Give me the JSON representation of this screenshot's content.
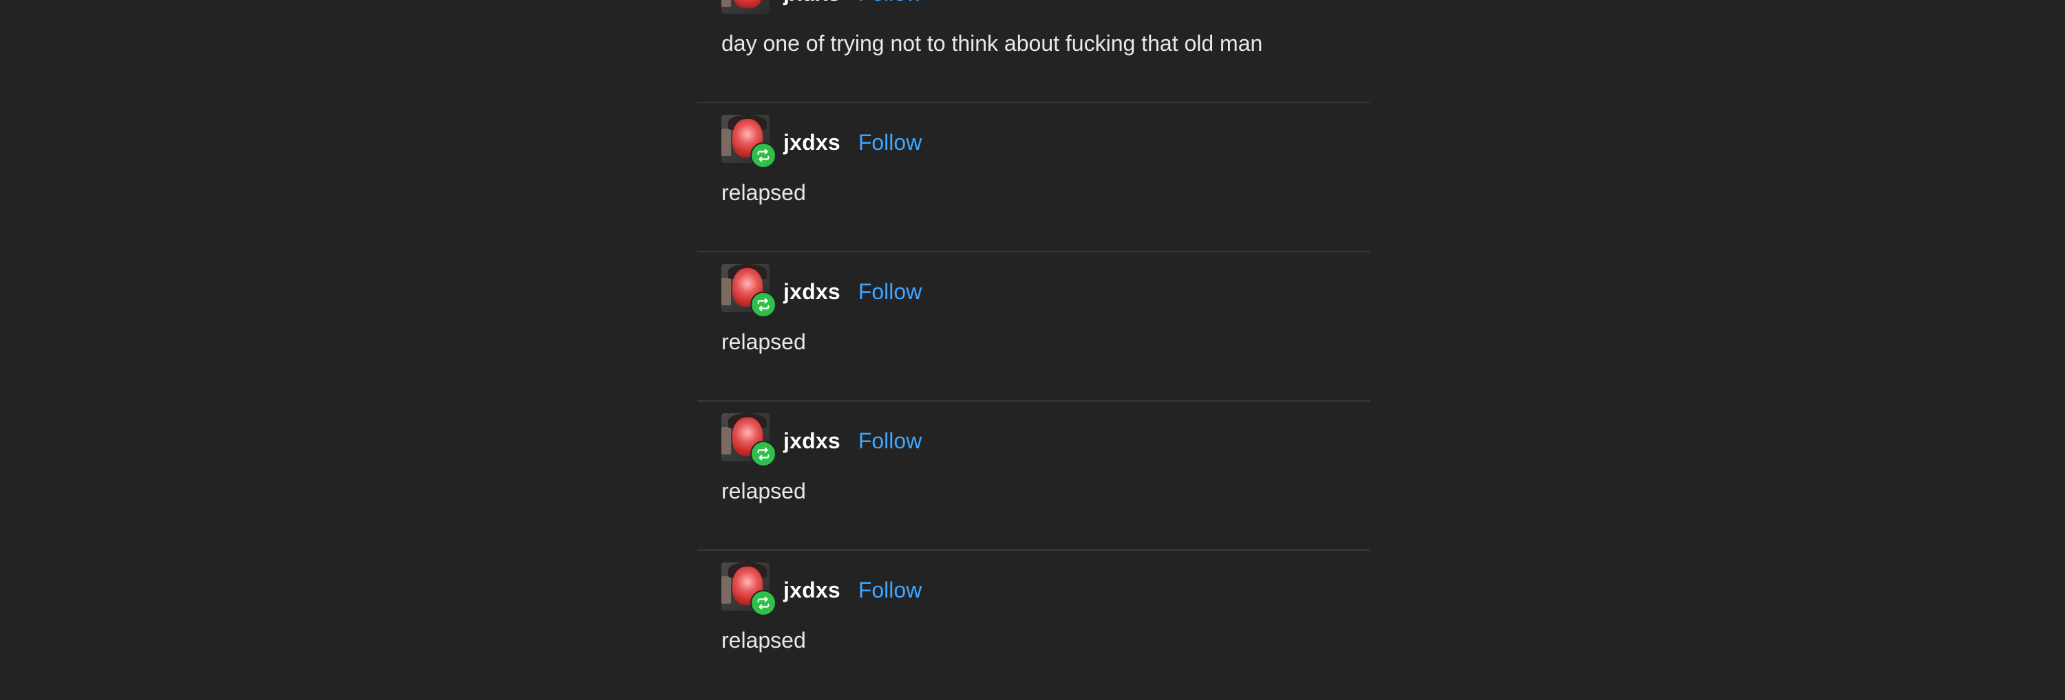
{
  "posts": [
    {
      "username": "jxdxs",
      "follow_label": "Follow",
      "text": "day one of trying not to think about fucking that old man",
      "reblogged": false
    },
    {
      "username": "jxdxs",
      "follow_label": "Follow",
      "text": "relapsed",
      "reblogged": true
    },
    {
      "username": "jxdxs",
      "follow_label": "Follow",
      "text": "relapsed",
      "reblogged": true
    },
    {
      "username": "jxdxs",
      "follow_label": "Follow",
      "text": "relapsed",
      "reblogged": true
    },
    {
      "username": "jxdxs",
      "follow_label": "Follow",
      "text": "relapsed",
      "reblogged": true
    }
  ],
  "colors": {
    "background": "#232323",
    "follow_link": "#3ea6ff",
    "reblog_badge": "#2fbf4b",
    "divider": "#383838"
  },
  "icons": {
    "reblog": "reblog-icon",
    "avatar": "avatar"
  }
}
